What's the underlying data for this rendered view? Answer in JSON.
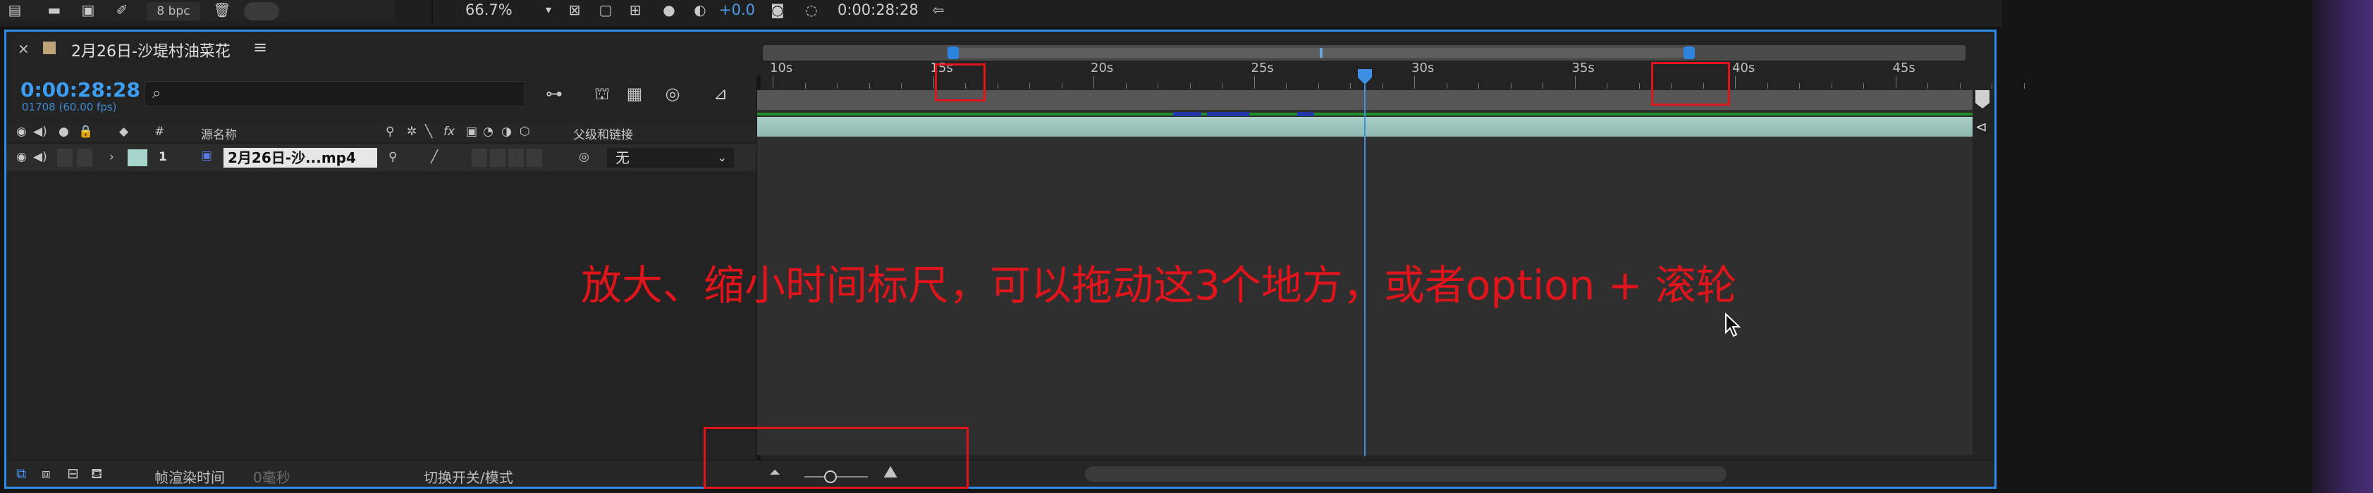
{
  "topbar": {
    "bpc_label": "8 bpc",
    "zoom": "66.7%",
    "exposure": "+0.0",
    "timecode": "0:00:28:28"
  },
  "composition": {
    "tab_title": "2月26日-沙堤村油菜花",
    "timecode": "0:00:28:28",
    "frames_fps": "01708 (60.00 fps)"
  },
  "layer_header": {
    "number": "#",
    "source_name": "源名称",
    "fx": "fx",
    "parent_link": "父级和链接"
  },
  "layer": {
    "number": "1",
    "name": "2月26日-沙...mp4",
    "parent": "无"
  },
  "ruler": {
    "labels": [
      "10s",
      "15s",
      "20s",
      "25s",
      "30s",
      "35s",
      "40s",
      "45s"
    ]
  },
  "annotation": "放大、缩小时间标尺，可以拖动这3个地方，或者option + 滚轮",
  "bottom_bar": {
    "render_time_label": "帧渲染时间",
    "render_time_value": "0毫秒",
    "toggle_label": "切换开关/模式"
  },
  "colors": {
    "accent_blue": "#2d8ceb",
    "annotation_red": "#e0141b",
    "layer_label": "#a7d4cc",
    "comp_swatch": "#bfa47a"
  }
}
